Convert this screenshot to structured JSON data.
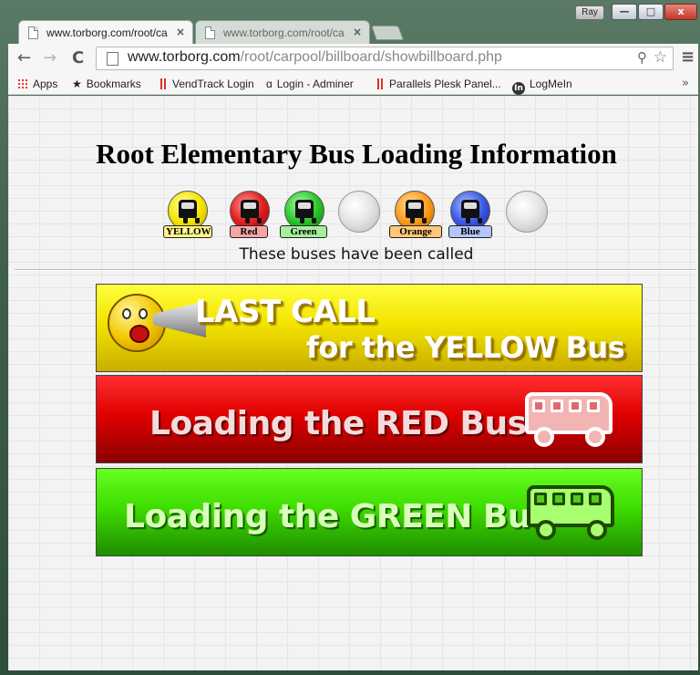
{
  "window": {
    "user_badge": "Ray",
    "min_glyph": "—",
    "max_glyph": "□",
    "close_glyph": "x"
  },
  "tabs": [
    {
      "title": "www.torborg.com/root/ca",
      "active": true,
      "close": "×"
    },
    {
      "title": "www.torborg.com/root/ca",
      "active": false,
      "close": "×"
    }
  ],
  "toolbar": {
    "back_glyph": "←",
    "forward_glyph": "→",
    "reload_glyph": "C",
    "url_host": "www.torborg.com",
    "url_path": "/root/carpool/billboard/showbillboard.php",
    "search_glyph": "⚲",
    "star_glyph": "☆",
    "menu_glyph": "≡"
  },
  "bookmarks": [
    {
      "label": "Apps",
      "icon": "apps-grid-icon"
    },
    {
      "label": "Bookmarks",
      "icon": "star-icon"
    },
    {
      "label": "VendTrack Login",
      "icon": "red-bars-icon"
    },
    {
      "label": "Login - Adminer",
      "icon": "adminer-icon"
    },
    {
      "label": "Parallels Plesk Panel...",
      "icon": "red-bars-icon"
    },
    {
      "label": "LogMeIn",
      "icon": "logmein-icon"
    }
  ],
  "bookmarks_overflow": "»",
  "page": {
    "title": "Root Elementary Bus Loading Information",
    "called_text": "These buses have been called",
    "bus_icons": [
      {
        "label": "YELLOW",
        "color": "#f5e600",
        "label_bg": "#fff48a"
      },
      {
        "label": "Red",
        "color": "#e32020",
        "label_bg": "#f4a6a6"
      },
      {
        "label": "Green",
        "color": "#2bc72b",
        "label_bg": "#a5ee9a"
      },
      {
        "label": "",
        "color": "empty"
      },
      {
        "label": "Orange",
        "color": "#ff9c1a",
        "label_bg": "#ffc777"
      },
      {
        "label": "Blue",
        "color": "#3a5be8",
        "label_bg": "#b6c4ff"
      },
      {
        "label": "",
        "color": "empty"
      }
    ],
    "banners": {
      "yellow": {
        "line1": "LAST CALL",
        "line2": "for the YELLOW Bus"
      },
      "red": {
        "text": "Loading the RED Bus"
      },
      "green": {
        "text": "Loading the GREEN Bus"
      }
    }
  }
}
